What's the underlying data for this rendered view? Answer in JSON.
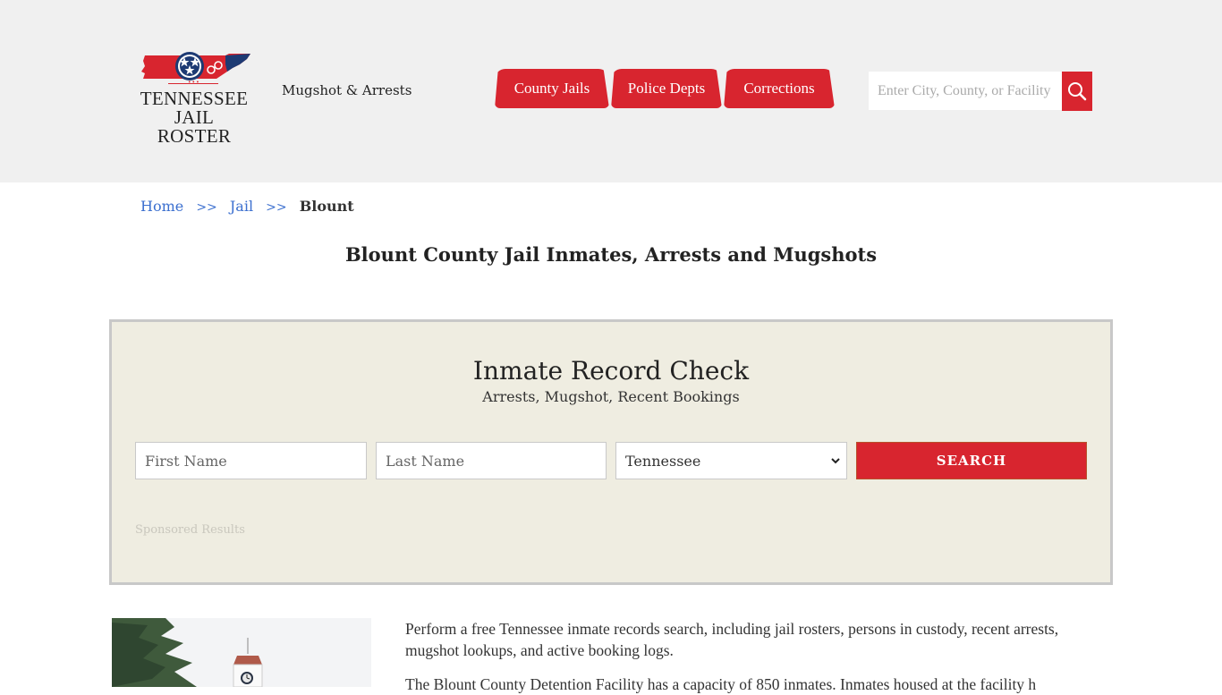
{
  "header": {
    "logo": {
      "line1": "TENNESSEE",
      "line2": "JAIL ROSTER",
      "dots": "•••"
    },
    "tagline": "Mugshot & Arrests",
    "nav": [
      {
        "label": "County Jails"
      },
      {
        "label": "Police Depts"
      },
      {
        "label": "Corrections"
      }
    ],
    "search": {
      "placeholder": "Enter City, County, or Facility",
      "value": ""
    }
  },
  "breadcrumb": {
    "items": [
      {
        "label": "Home"
      },
      {
        "label": "Jail"
      }
    ],
    "separator": ">>",
    "current": "Blount"
  },
  "page_title": "Blount County Jail Inmates, Arrests and Mugshots",
  "record_check": {
    "title": "Inmate Record Check",
    "subtitle": "Arrests, Mugshot, Recent Bookings",
    "first_name_placeholder": "First Name",
    "last_name_placeholder": "Last Name",
    "state_selected": "Tennessee",
    "submit_label": "SEARCH",
    "sponsored_label": "Sponsored Results"
  },
  "content": {
    "paragraphs": [
      "Perform a free Tennessee inmate records search, including jail rosters, persons in custody, recent arrests, mugshot lookups, and active booking logs.",
      "The Blount County Detention Facility has a capacity of 850 inmates. Inmates housed at the facility h"
    ]
  },
  "colors": {
    "brand_red": "#d8252f",
    "brand_navy": "#1d3a73",
    "header_bg": "#f0f0f0",
    "panel_bg": "#efede1",
    "link_blue": "#3b6fcf"
  }
}
